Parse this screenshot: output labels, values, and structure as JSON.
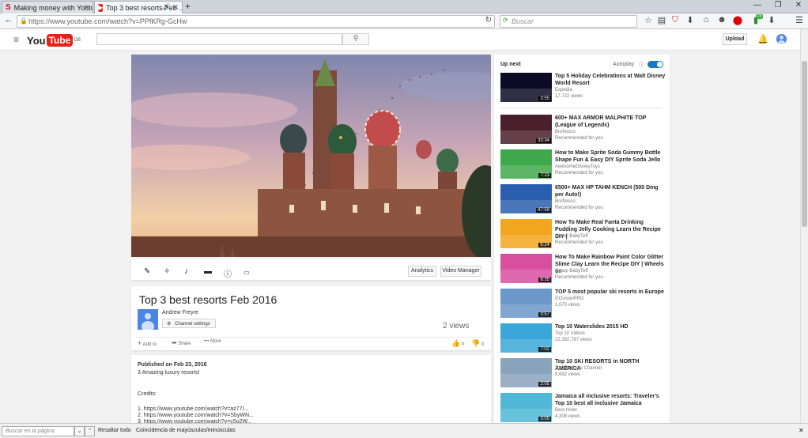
{
  "tabs": [
    {
      "title": "Making money with Youtu...",
      "favicon": "S"
    },
    {
      "title": "Top 3 best resorts Feb ...",
      "favicon": "▶"
    }
  ],
  "nav": {
    "url": "https://www.youtube.com/watch?v=PPfKRg-GcHw",
    "search_placeholder": "Buscar",
    "addon_badge": "15"
  },
  "yt": {
    "logo_you": "You",
    "logo_tube": "Tube",
    "logo_region": "GB",
    "upload_label": "Upload"
  },
  "editor": {
    "analytics_label": "Analytics",
    "video_manager_label": "Video Manager"
  },
  "video": {
    "title": "Top 3 best resorts Feb 2016",
    "channel": "Andrew Freyre",
    "channel_settings": "Channel settings",
    "views": "2 views",
    "add_to": "Add to",
    "share": "Share",
    "more": "More",
    "likes": "0",
    "dislikes": "0",
    "published": "Published on Feb 23, 2016",
    "description": [
      "3 Amazing luxury resorts!",
      "",
      "Credits:",
      "",
      "1. https://www.youtube.com/watch?v=az77I...",
      "2. https://www.youtube.com/watch?v=SbyWN...",
      "3. https://www.youtube.com/watch?v=c5o2W..."
    ]
  },
  "sidebar": {
    "up_next": "Up next",
    "autoplay": "Autoplay",
    "items": [
      {
        "title": "Top 5 Holiday Celebrations at Walt Disney World Resort",
        "channel": "Expedia",
        "meta": "17,722 views",
        "duration": "3:55",
        "thumb_color": "#0b0b25"
      },
      {
        "title": "600+ MAX ARMOR MALPHITE TOP (League of Legends)",
        "channel": "Brofresco",
        "meta": "Recommended for you",
        "duration": "33:34",
        "thumb_color": "#4a1f2c"
      },
      {
        "title": "How to Make Sprite Soda Gummy Bottle Shape Fun & Easy DIY Sprite Soda Jello",
        "channel": "AwesomeDisneyToys",
        "meta": "Recommended for you",
        "duration": "7:23",
        "thumb_color": "#3fa84a"
      },
      {
        "title": "6500+ MAX HP TAHM KENCH (500 Dmg per Auto!)",
        "channel": "Brofresco",
        "meta": "Recommended for you",
        "duration": "47:59",
        "thumb_color": "#2a5fb0"
      },
      {
        "title": "How To Make Real Fanta Drinking Pudding Jelly Cooking Learn the Recipe DIY |",
        "channel": "Group BabyTeff",
        "meta": "Recommended for you",
        "duration": "6:24",
        "thumb_color": "#f2a51e"
      },
      {
        "title": "How To Make Rainbow Paint Color Glitter Slime Clay Learn the Recipe DIY | Wheels on",
        "channel": "Group BabyTeff",
        "meta": "Recommended for you",
        "duration": "8:35",
        "thumb_color": "#d94fa0"
      },
      {
        "title": "TOP 5 most popular ski resorts in Europe",
        "channel": "GOsnowPRO",
        "meta": "1,070 views",
        "duration": "3:57",
        "thumb_color": "#6c97c9"
      },
      {
        "title": "Top 10 Waterslides 2015 HD",
        "channel": "Top 10 Videos",
        "meta": "22,392,787 views",
        "duration": "7:02",
        "thumb_color": "#3aa7d8"
      },
      {
        "title": "Top 10 SKI RESORTS in NORTH AMERICA",
        "channel": "Top Ten Lists Channel",
        "meta": "9,692 views",
        "duration": "2:05",
        "thumb_color": "#8aa3bd"
      },
      {
        "title": "Jamaica all inclusive resorts: Traveler's Top 10 best all inclusive Jamaica",
        "channel": "Best Hotel",
        "meta": "4,308 views",
        "duration": "3:05",
        "thumb_color": "#4fb8d6"
      }
    ]
  },
  "findbar": {
    "placeholder": "Buscar en la página",
    "highlight_all": "Resaltar todo",
    "match_case": "Coincidencia de mayúsculas/minúsculas"
  }
}
